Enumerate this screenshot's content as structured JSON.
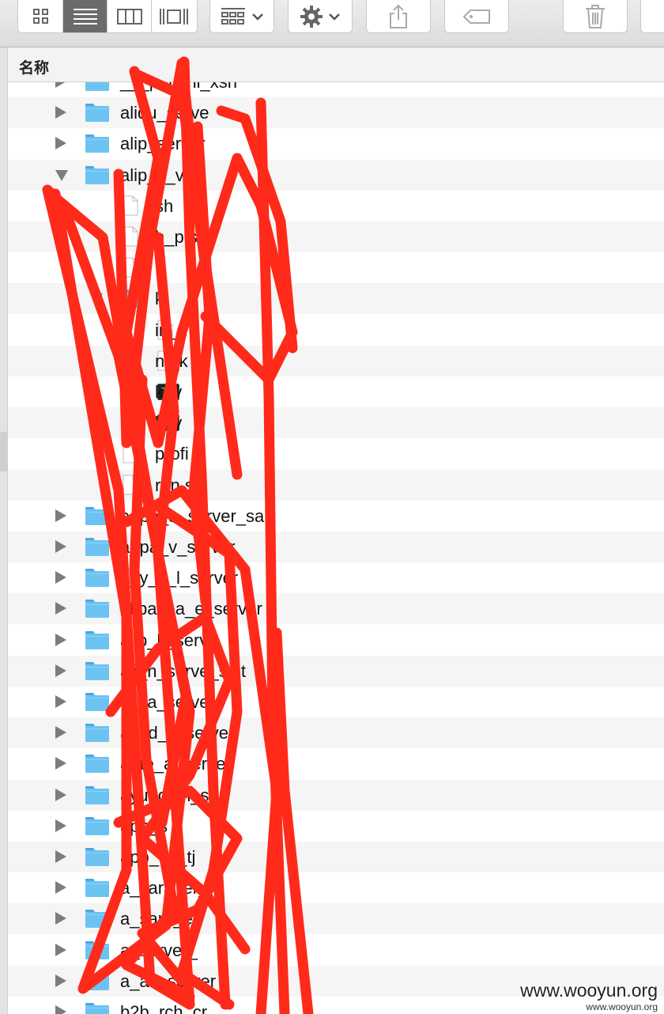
{
  "toolbar": {
    "view_buttons": [
      {
        "icon": "icon-view-icon"
      },
      {
        "icon": "list-view-icon",
        "active": true
      },
      {
        "icon": "column-view-icon"
      },
      {
        "icon": "cover-flow-icon"
      }
    ],
    "arrange_icon": "arrange-icon",
    "action_icon": "gear-icon",
    "share_icon": "share-icon",
    "tag_icon": "tag-icon",
    "trash_icon": "trash-icon"
  },
  "header": {
    "name_column": "名称"
  },
  "rows": [
    {
      "indent": 0,
      "kind": "folder",
      "disclosure": "closed",
      "name": "___pansnl_xsn"
    },
    {
      "indent": 0,
      "kind": "folder",
      "disclosure": "closed",
      "name": "aliqu_serve"
    },
    {
      "indent": 0,
      "kind": "folder",
      "disclosure": "closed",
      "name": "alip_server"
    },
    {
      "indent": 0,
      "kind": "folder",
      "disclosure": "open",
      "name": "alip_s_ver"
    },
    {
      "indent": 1,
      "kind": "file",
      "name": "sh"
    },
    {
      "indent": 1,
      "kind": "file",
      "name": "h_p.sh"
    },
    {
      "indent": 1,
      "kind": "file",
      "name": "i"
    },
    {
      "indent": 1,
      "kind": "folder",
      "disclosure": "open",
      "name": "k"
    },
    {
      "indent": 2,
      "kind": "file",
      "name": "in_k"
    },
    {
      "indent": 2,
      "kind": "file",
      "name": "nt_k"
    },
    {
      "indent": 2,
      "kind": "terminal",
      "name": "key"
    },
    {
      "indent": 2,
      "kind": "terminal",
      "name": "key"
    },
    {
      "indent": 1,
      "kind": "file",
      "name": "profi"
    },
    {
      "indent": 1,
      "kind": "file",
      "name": "run.s"
    },
    {
      "indent": 0,
      "kind": "folder",
      "disclosure": "closed",
      "name": "a_pa_a_server_salt"
    },
    {
      "indent": 0,
      "kind": "folder",
      "disclosure": "closed",
      "name": "a_pa_v_server"
    },
    {
      "indent": 0,
      "kind": "folder",
      "disclosure": "closed",
      "name": "a_y_y_l_server"
    },
    {
      "indent": 0,
      "kind": "folder",
      "disclosure": "closed",
      "name": "alipay_a_e_server"
    },
    {
      "indent": 0,
      "kind": "folder",
      "disclosure": "closed",
      "name": "alip_k_serve"
    },
    {
      "indent": 0,
      "kind": "folder",
      "disclosure": "closed",
      "name": "ali_n_serve_salt"
    },
    {
      "indent": 0,
      "kind": "folder",
      "disclosure": "closed",
      "name": "ali_a_server"
    },
    {
      "indent": 0,
      "kind": "folder",
      "disclosure": "closed",
      "name": "a_yd_x_server"
    },
    {
      "indent": 0,
      "kind": "folder",
      "disclosure": "closed",
      "name": "a_te_a_server"
    },
    {
      "indent": 0,
      "kind": "folder",
      "disclosure": "closed",
      "name": "ayu_com_ser"
    },
    {
      "indent": 0,
      "kind": "folder",
      "disclosure": "closed",
      "name": "app_s"
    },
    {
      "indent": 0,
      "kind": "folder",
      "disclosure": "closed",
      "name": "app_se_tj"
    },
    {
      "indent": 0,
      "kind": "folder",
      "disclosure": "closed",
      "name": "a_sara_er_"
    },
    {
      "indent": 0,
      "kind": "folder",
      "disclosure": "closed",
      "name": "a_sara_er"
    },
    {
      "indent": 0,
      "kind": "folder",
      "disclosure": "closed",
      "name": "a_server_"
    },
    {
      "indent": 0,
      "kind": "folder",
      "disclosure": "closed",
      "name": "a_av_server"
    },
    {
      "indent": 0,
      "kind": "folder",
      "disclosure": "closed",
      "name": "b2b_rch_cr"
    }
  ],
  "watermark": {
    "main": "www.wooyun.org",
    "small": "www.wooyun.org"
  },
  "colors": {
    "folder": "#6cc3f2",
    "scribble": "#ff2a1a",
    "row_alt": "#f5f5f5"
  }
}
